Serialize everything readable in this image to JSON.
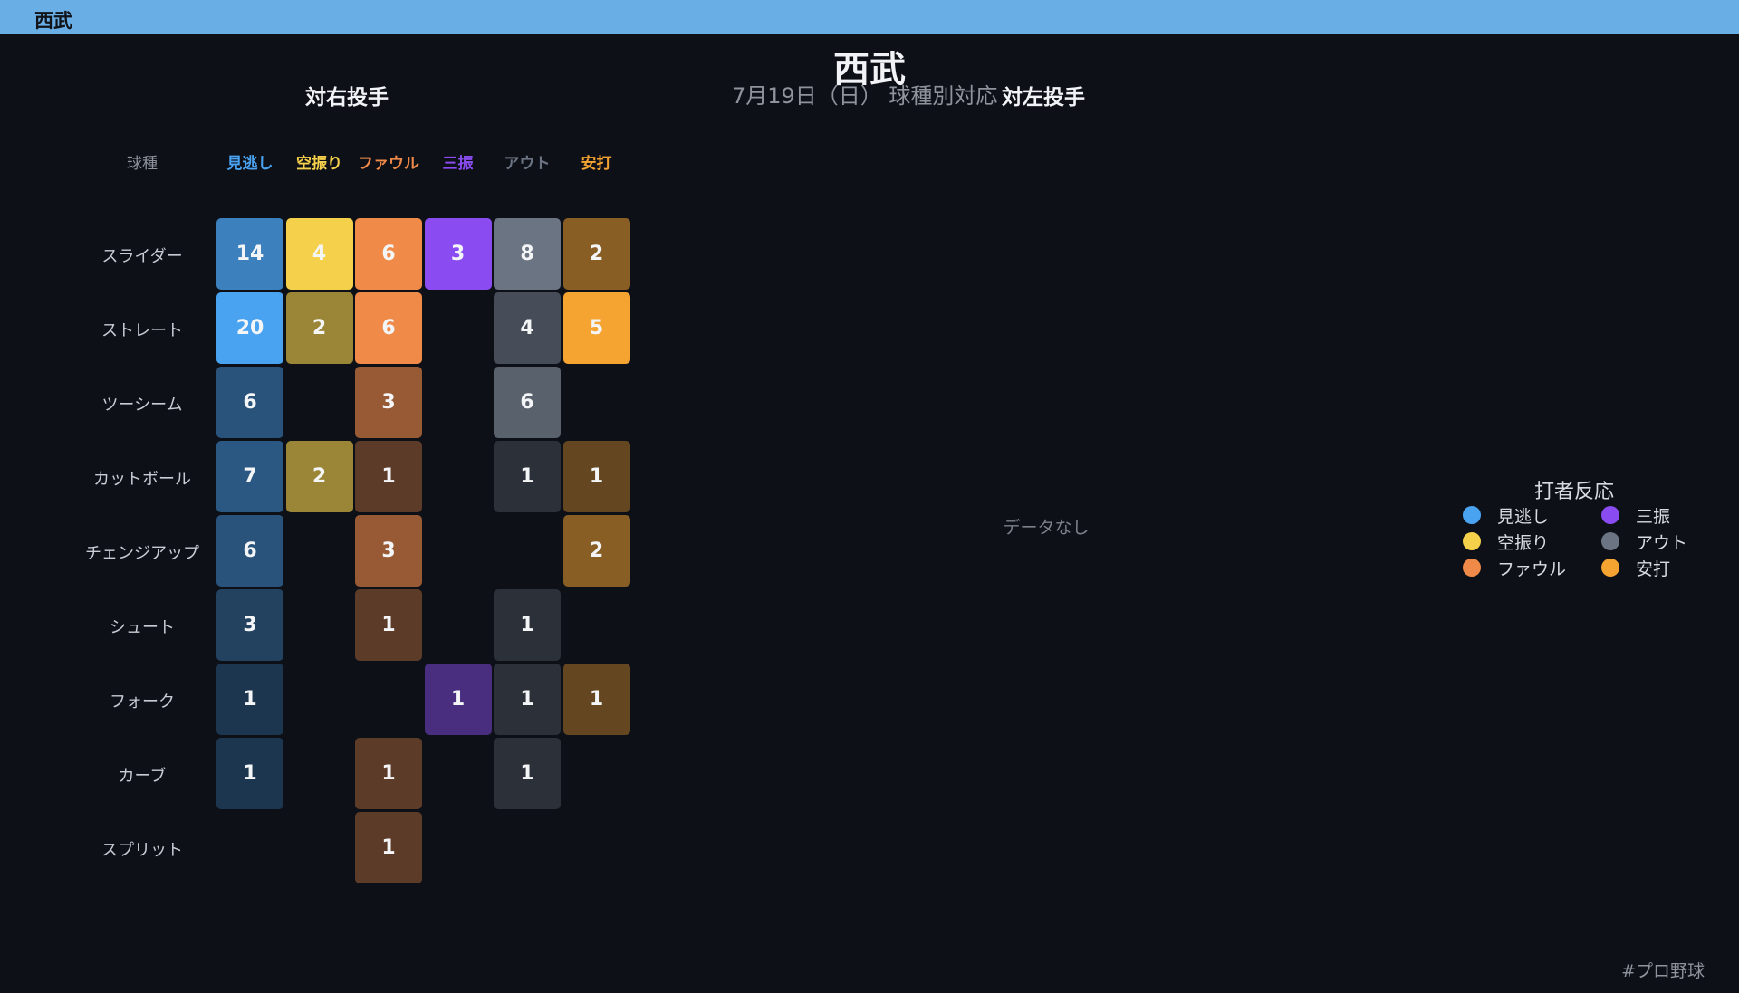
{
  "header": {
    "app_title": "西武"
  },
  "title": "西武",
  "subtitle": "7月19日（日） 球種別対応",
  "panels": {
    "right": "対右投手",
    "left": "対左投手",
    "no_data": "データなし"
  },
  "corner_label": "球種",
  "legend": {
    "title": "打者反応",
    "items": [
      {
        "label": "見逃し",
        "color": "#4aa3f0"
      },
      {
        "label": "空振り",
        "color": "#f5d04a"
      },
      {
        "label": "ファウル",
        "color": "#f08a48"
      },
      {
        "label": "三振",
        "color": "#8a4cf0"
      },
      {
        "label": "アウト",
        "color": "#6b7482"
      },
      {
        "label": "安打",
        "color": "#f5a331"
      }
    ]
  },
  "hashtag": "#プロ野球",
  "chart_data": {
    "type": "heatmap",
    "title": "対右投手",
    "columns": [
      "見逃し",
      "空振り",
      "ファウル",
      "三振",
      "アウト",
      "安打"
    ],
    "column_colors": [
      "#4aa3f0",
      "#f5d04a",
      "#f08a48",
      "#8a4cf0",
      "#6b7482",
      "#f5a331"
    ],
    "rows": [
      "スライダー",
      "ストレート",
      "ツーシーム",
      "カットボール",
      "チェンジアップ",
      "シュート",
      "フォーク",
      "カーブ",
      "スプリット"
    ],
    "values": [
      [
        14,
        4,
        6,
        3,
        8,
        2
      ],
      [
        20,
        2,
        6,
        0,
        4,
        5
      ],
      [
        6,
        0,
        3,
        0,
        6,
        0
      ],
      [
        7,
        2,
        1,
        0,
        1,
        1
      ],
      [
        6,
        0,
        3,
        0,
        0,
        2
      ],
      [
        3,
        0,
        1,
        0,
        1,
        0
      ],
      [
        1,
        0,
        0,
        1,
        1,
        1
      ],
      [
        1,
        0,
        1,
        0,
        1,
        0
      ],
      [
        0,
        0,
        1,
        0,
        0,
        0
      ]
    ]
  }
}
